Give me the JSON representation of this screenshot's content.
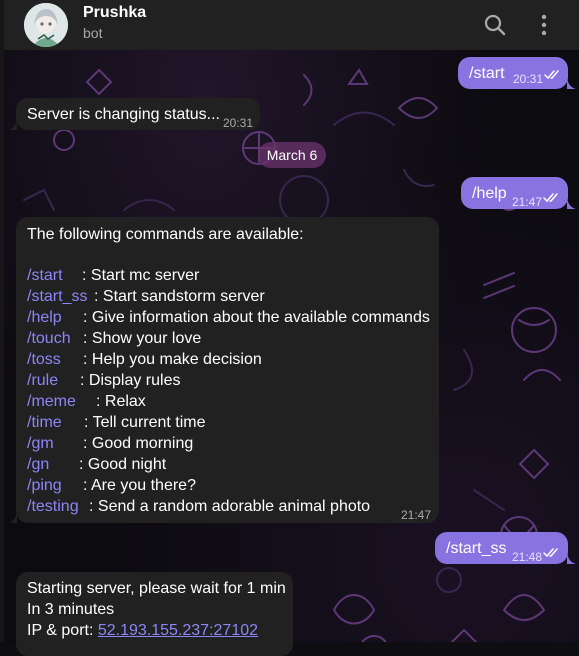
{
  "header": {
    "title": "Prushka",
    "subtitle": "bot",
    "icons": [
      "search-icon",
      "more-vertical-icon"
    ]
  },
  "date_separator": "March 6",
  "messages": {
    "m1": {
      "text": "/start",
      "time": "20:31"
    },
    "m2": {
      "text": "Server is changing status...",
      "time": "20:31"
    },
    "m3": {
      "text": "/help",
      "time": "21:47"
    },
    "m4": {
      "heading": "The following commands are available:",
      "time": "21:47",
      "commands": [
        {
          "cmd": "/start",
          "desc": ": Start mc server"
        },
        {
          "cmd": "/start_ss",
          "desc": ": Start sandstorm server"
        },
        {
          "cmd": "/help",
          "desc": ": Give information about the available commands"
        },
        {
          "cmd": "/touch",
          "desc": ": Show your love"
        },
        {
          "cmd": "/toss",
          "desc": ": Help you make decision"
        },
        {
          "cmd": "/rule",
          "desc": ": Display rules"
        },
        {
          "cmd": "/meme",
          "desc": ": Relax"
        },
        {
          "cmd": "/time",
          "desc": ": Tell current time"
        },
        {
          "cmd": "/gm",
          "desc": ": Good morning"
        },
        {
          "cmd": "/gn",
          "desc": ": Good night"
        },
        {
          "cmd": "/ping",
          "desc": ": Are you there?"
        },
        {
          "cmd": "/testing",
          "desc": ": Send a random adorable animal photo"
        }
      ]
    },
    "m5": {
      "text": "/start_ss",
      "time": "21:48"
    },
    "m6": {
      "line1": "Starting server, please wait for 1 min",
      "line2": "In 3 minutes",
      "line3_label": "IP & port: ",
      "line3_link": "52.193.155.237:27102"
    }
  },
  "colors": {
    "header_bg": "#212121",
    "incoming_bubble": "#212121",
    "outgoing_bubble": "#8774e1",
    "command_link": "#8e86f7",
    "date_pill": "#6c346e"
  }
}
